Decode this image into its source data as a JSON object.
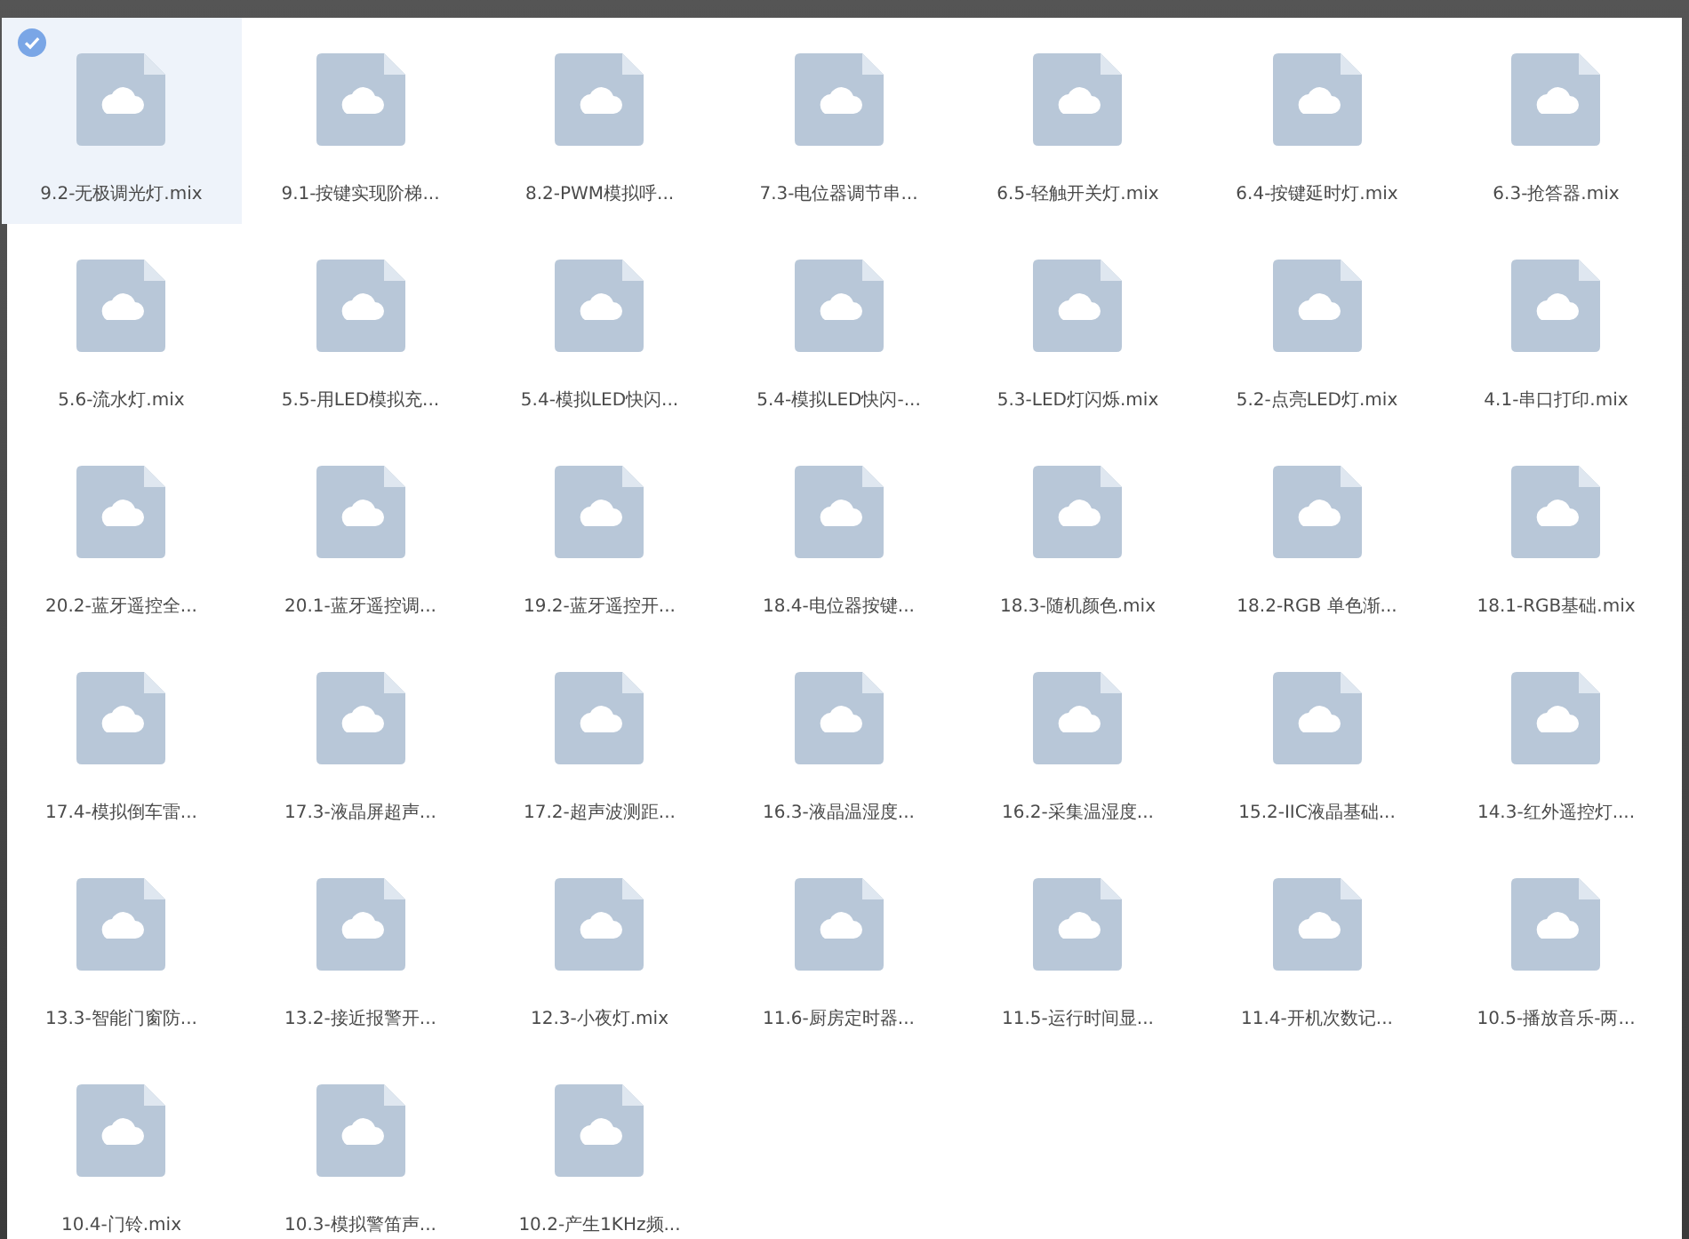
{
  "files": [
    {
      "name": "9.2-无极调光灯.mix",
      "selected": true
    },
    {
      "name": "9.1-按键实现阶梯...",
      "selected": false
    },
    {
      "name": "8.2-PWM模拟呼...",
      "selected": false
    },
    {
      "name": "7.3-电位器调节串...",
      "selected": false
    },
    {
      "name": "6.5-轻触开关灯.mix",
      "selected": false
    },
    {
      "name": "6.4-按键延时灯.mix",
      "selected": false
    },
    {
      "name": "6.3-抢答器.mix",
      "selected": false
    },
    {
      "name": "5.6-流水灯.mix",
      "selected": false
    },
    {
      "name": "5.5-用LED模拟充...",
      "selected": false
    },
    {
      "name": "5.4-模拟LED快闪...",
      "selected": false
    },
    {
      "name": "5.4-模拟LED快闪-...",
      "selected": false
    },
    {
      "name": "5.3-LED灯闪烁.mix",
      "selected": false
    },
    {
      "name": "5.2-点亮LED灯.mix",
      "selected": false
    },
    {
      "name": "4.1-串口打印.mix",
      "selected": false
    },
    {
      "name": "20.2-蓝牙遥控全...",
      "selected": false
    },
    {
      "name": "20.1-蓝牙遥控调...",
      "selected": false
    },
    {
      "name": "19.2-蓝牙遥控开...",
      "selected": false
    },
    {
      "name": "18.4-电位器按键...",
      "selected": false
    },
    {
      "name": "18.3-随机颜色.mix",
      "selected": false
    },
    {
      "name": "18.2-RGB 单色渐...",
      "selected": false
    },
    {
      "name": "18.1-RGB基础.mix",
      "selected": false
    },
    {
      "name": "17.4-模拟倒车雷...",
      "selected": false
    },
    {
      "name": "17.3-液晶屏超声...",
      "selected": false
    },
    {
      "name": "17.2-超声波测距...",
      "selected": false
    },
    {
      "name": "16.3-液晶温湿度...",
      "selected": false
    },
    {
      "name": "16.2-采集温湿度...",
      "selected": false
    },
    {
      "name": "15.2-IIC液晶基础...",
      "selected": false
    },
    {
      "name": "14.3-红外遥控灯....",
      "selected": false
    },
    {
      "name": "13.3-智能门窗防...",
      "selected": false
    },
    {
      "name": "13.2-接近报警开...",
      "selected": false
    },
    {
      "name": "12.3-小夜灯.mix",
      "selected": false
    },
    {
      "name": "11.6-厨房定时器...",
      "selected": false
    },
    {
      "name": "11.5-运行时间显...",
      "selected": false
    },
    {
      "name": "11.4-开机次数记...",
      "selected": false
    },
    {
      "name": "10.5-播放音乐-两...",
      "selected": false
    },
    {
      "name": "10.4-门铃.mix",
      "selected": false
    },
    {
      "name": "10.3-模拟警笛声...",
      "selected": false
    },
    {
      "name": "10.2-产生1KHz频...",
      "selected": false
    }
  ]
}
